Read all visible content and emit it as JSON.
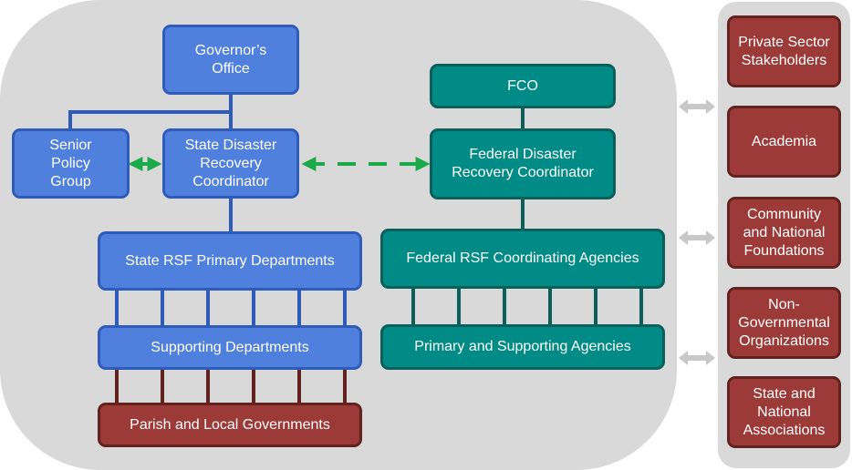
{
  "diagram": {
    "colors": {
      "state_blue": "#5080dd",
      "federal_teal": "#018b86",
      "partner_red": "#9c3a38",
      "green_arrow": "#1aaa4a",
      "gray_arrow": "#c8c8c8",
      "panel_gray": "#d9d9d9"
    },
    "state": {
      "governors_office": "Governor’s Office",
      "senior_policy_group": "Senior Policy Group",
      "state_disaster_recovery_coordinator": "State Disaster Recovery Coordinator",
      "state_rsf_primary_departments": "State RSF Primary Departments",
      "supporting_departments": "Supporting Departments",
      "parish_and_local_governments": "Parish and Local Governments"
    },
    "federal": {
      "fco": "FCO",
      "federal_disaster_recovery_coordinator": "Federal Disaster Recovery Coordinator",
      "federal_rsf_coordinating_agencies": "Federal RSF Coordinating Agencies",
      "primary_and_supporting_agencies": "Primary and Supporting Agencies"
    },
    "partners": [
      "Private Sector Stakeholders",
      "Academia",
      "Community and National Foundations",
      "Non-Governmental Organizations",
      "State and National Associations"
    ],
    "links": {
      "spg_sdrc": "bidirectional solid green",
      "sdrc_fdrc": "bidirectional dashed green",
      "panel_partners": "bidirectional gray (3)"
    }
  }
}
